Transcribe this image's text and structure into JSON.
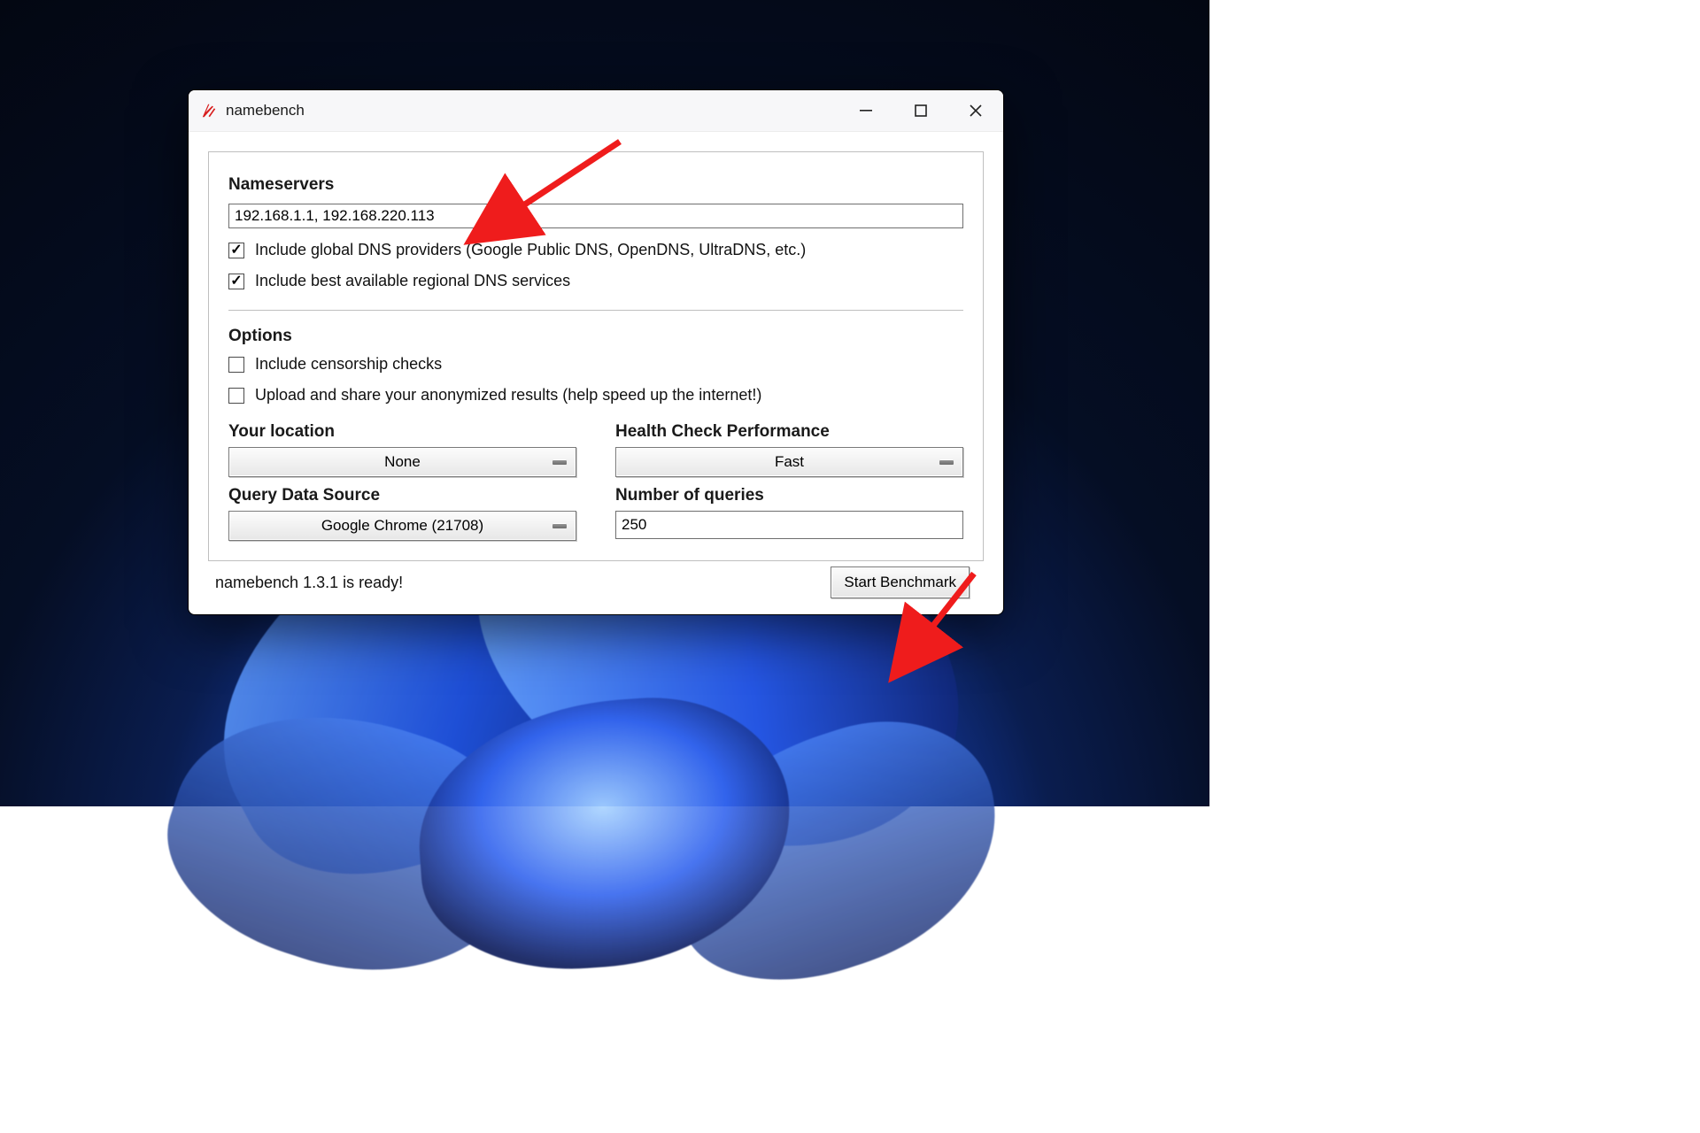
{
  "window": {
    "title": "namebench"
  },
  "nameservers": {
    "heading": "Nameservers",
    "value": "192.168.1.1, 192.168.220.113",
    "include_global": {
      "checked": true,
      "label": "Include global DNS providers (Google Public DNS, OpenDNS, UltraDNS, etc.)"
    },
    "include_regional": {
      "checked": true,
      "label": "Include best available regional DNS services"
    }
  },
  "options": {
    "heading": "Options",
    "censorship": {
      "checked": false,
      "label": "Include censorship checks"
    },
    "upload": {
      "checked": false,
      "label": "Upload and share your anonymized results (help speed up the internet!)"
    }
  },
  "location": {
    "label": "Your location",
    "value": "None"
  },
  "health": {
    "label": "Health Check Performance",
    "value": "Fast"
  },
  "source": {
    "label": "Query Data Source",
    "value": "Google Chrome (21708)"
  },
  "queries": {
    "label": "Number of queries",
    "value": "250"
  },
  "footer": {
    "status": "namebench 1.3.1 is ready!",
    "start_label": "Start Benchmark"
  }
}
